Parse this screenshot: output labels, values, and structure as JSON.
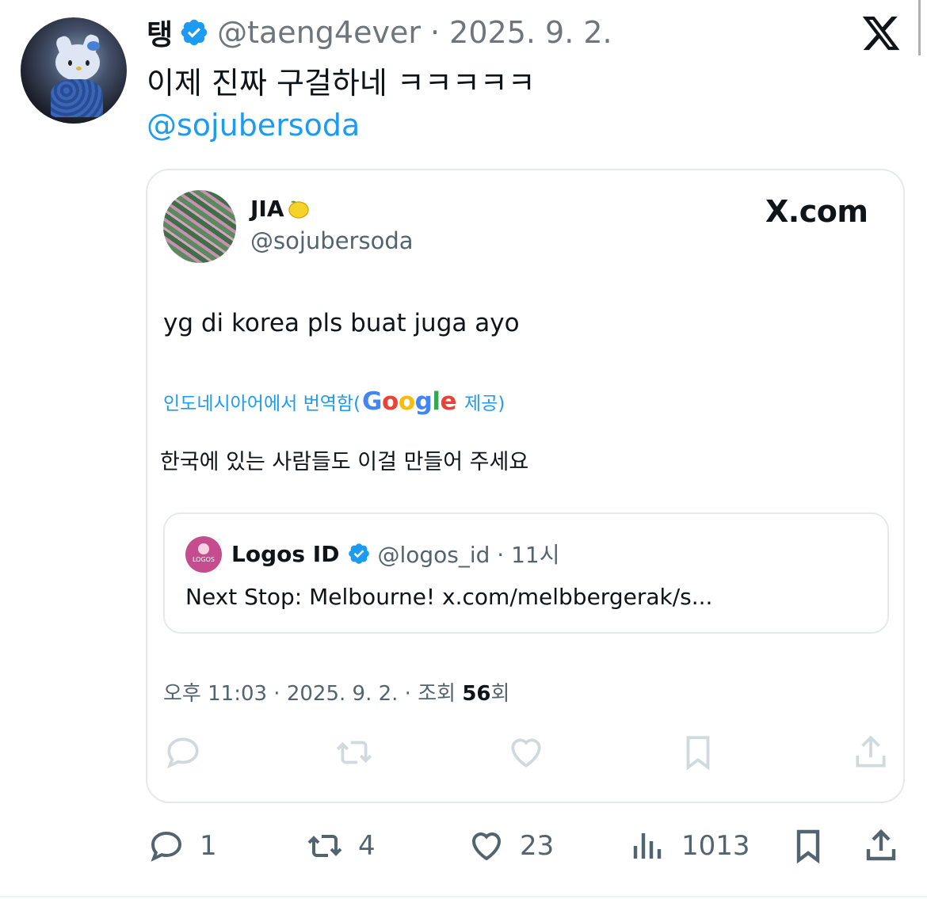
{
  "tweet": {
    "display_name": "탱",
    "handle_meta": "@taeng4ever · 2025. 9. 2.",
    "text": "이제 진짜 구걸하네 ㅋㅋㅋㅋㅋ",
    "mention": "@sojubersoda"
  },
  "embed": {
    "name": "JIA",
    "emoji_icon": "lemon-icon",
    "handle": "@sojubersoda",
    "brand": "X.com",
    "body": "yg di korea pls buat juga ayo",
    "translate_prefix": "인도네시아어에서 번역함(",
    "translate_suffix": "제공)",
    "google": [
      "G",
      "o",
      "o",
      "g",
      "l",
      "e"
    ],
    "translated": "한국에 있는 사람들도 이걸 만들어 주세요",
    "quote": {
      "name": "Logos ID",
      "meta": "@logos_id · 11시",
      "text": "Next Stop: Melbourne! x.com/melbbergerak/s...",
      "avatar_text": "LOGOS"
    },
    "timestamp_prefix": "오후 11:03 · 2025. 9. 2. · 조회 ",
    "views": "56",
    "timestamp_suffix": "회"
  },
  "actions": {
    "replies": "1",
    "retweets": "4",
    "likes": "23",
    "views": "1013"
  },
  "colors": {
    "accent": "#1d9bf0",
    "muted": "#536471",
    "text": "#0f1419"
  }
}
